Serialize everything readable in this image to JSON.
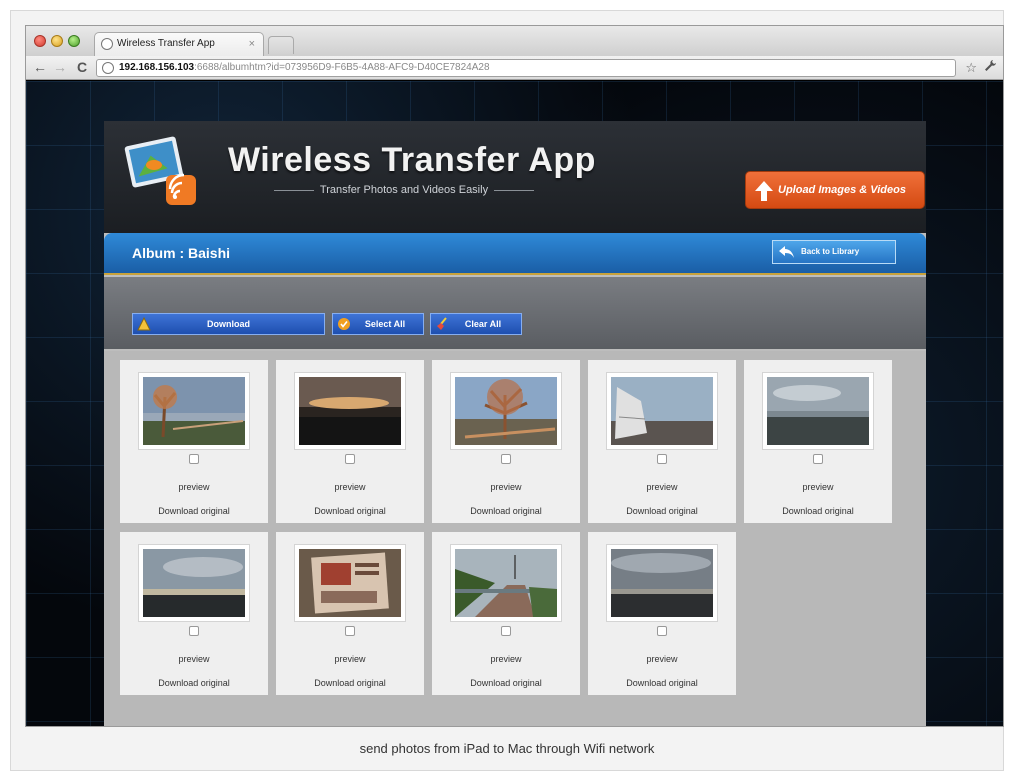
{
  "browser": {
    "tab_title": "Wireless Transfer App",
    "tab_close": "×",
    "url_host": "192.168.156.103",
    "url_rest": ":6688/albumhtm?id=073956D9-F6B5-4A88-AFC9-D40CE7824A28",
    "back_icon": "←",
    "forward_icon": "→",
    "reload_icon": "C",
    "star_icon": "☆",
    "wrench_icon": "🔧"
  },
  "app": {
    "title": "Wireless Transfer App",
    "subtitle": "Transfer Photos and Videos Easily",
    "upload_label": "Upload Images & Videos"
  },
  "album": {
    "title": "Album : Baishi",
    "back_label": "Back to Library"
  },
  "actions": {
    "download_label": "Download",
    "select_all_label": "Select All",
    "clear_all_label": "Clear All"
  },
  "photos": [
    {
      "preview": "preview",
      "download": "Download original",
      "scene": "tree-sunset"
    },
    {
      "preview": "preview",
      "download": "Download original",
      "scene": "dark-sunset"
    },
    {
      "preview": "preview",
      "download": "Download original",
      "scene": "tree-sky"
    },
    {
      "preview": "preview",
      "download": "Download original",
      "scene": "boat-rock"
    },
    {
      "preview": "preview",
      "download": "Download original",
      "scene": "cloudy-shore"
    },
    {
      "preview": "preview",
      "download": "Download original",
      "scene": "cloudy-horizon"
    },
    {
      "preview": "preview",
      "download": "Download original",
      "scene": "map-sign"
    },
    {
      "preview": "preview",
      "download": "Download original",
      "scene": "path-trees"
    },
    {
      "preview": "preview",
      "download": "Download original",
      "scene": "grey-sea"
    }
  ],
  "caption": "send photos from iPad to Mac through Wifi network",
  "colors": {
    "accent_blue": "#2f8ad8",
    "upload_orange": "#e55d22",
    "button_blue": "#2a5fc4"
  }
}
